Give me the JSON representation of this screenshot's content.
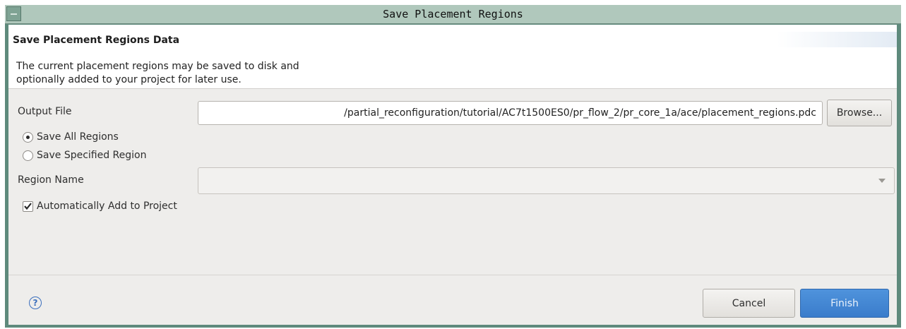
{
  "window": {
    "title": "Save Placement Regions"
  },
  "header": {
    "title": "Save Placement Regions Data",
    "description_line1": "The current placement regions may be saved to disk and",
    "description_line2": "optionally added to your project for later use."
  },
  "form": {
    "output_file_label": "Output File",
    "output_file_value": "/partial_reconfiguration/tutorial/AC7t1500ES0/pr_flow_2/pr_core_1a/ace/placement_regions.pdc",
    "browse_label": "Browse...",
    "radio_all_label": "Save All Regions",
    "radio_all_selected": true,
    "radio_specified_label": "Save Specified Region",
    "radio_specified_selected": false,
    "region_name_label": "Region Name",
    "region_name_value": "",
    "auto_add_label": "Automatically Add to Project",
    "auto_add_checked": true
  },
  "footer": {
    "help_glyph": "?",
    "cancel_label": "Cancel",
    "finish_label": "Finish"
  },
  "colors": {
    "frame": "#5e8a7c",
    "titlebar": "#b0c8bc",
    "dialog_bg": "#eeedeb",
    "primary_button": "#4388d6",
    "help_icon": "#3b6fbd"
  }
}
